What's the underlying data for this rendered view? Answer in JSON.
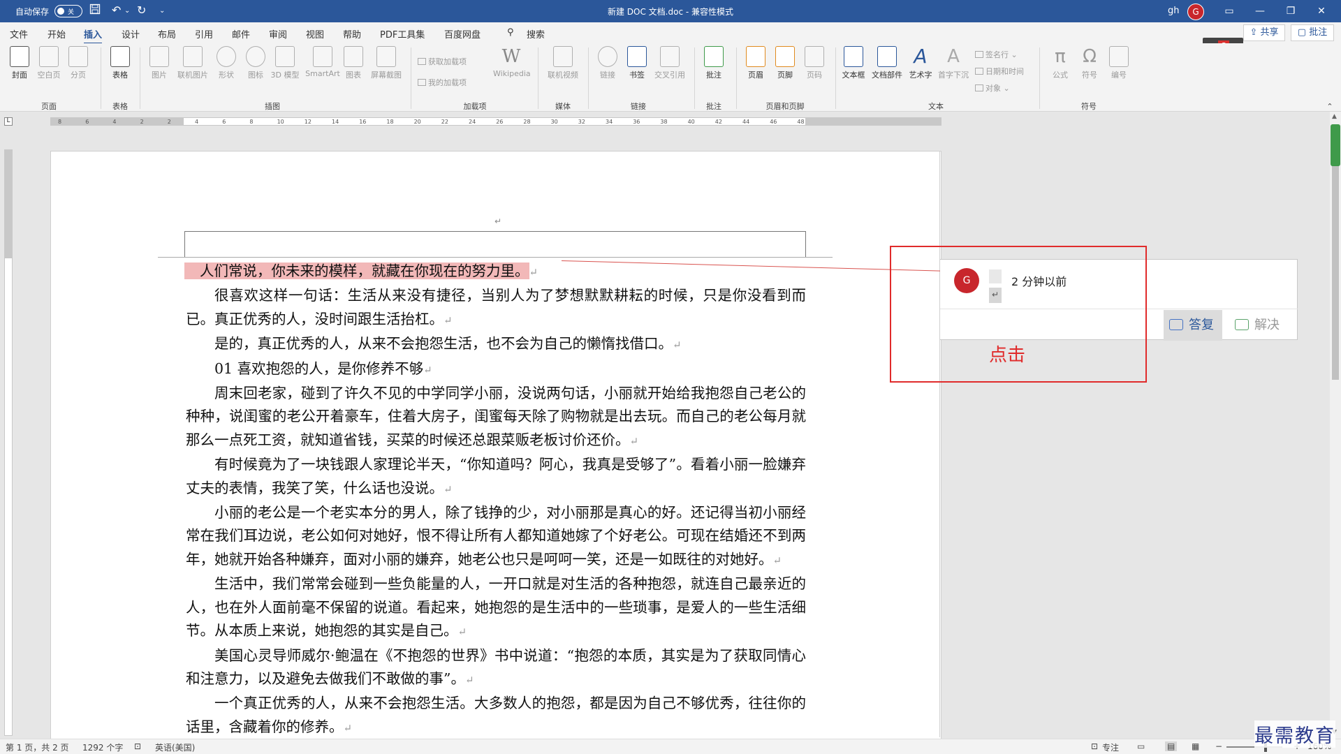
{
  "titlebar": {
    "autosave_label": "自动保存",
    "autosave_state": "关",
    "doc_title": "新建 DOC 文档.doc  -  兼容性模式",
    "user": "gh",
    "avatar_letter": "G",
    "minimize": "—",
    "restore": "❐",
    "close": "✕",
    "display_options": "▭"
  },
  "menu": {
    "tabs": [
      "文件",
      "开始",
      "插入",
      "设计",
      "布局",
      "引用",
      "邮件",
      "审阅",
      "视图",
      "帮助",
      "PDF工具集",
      "百度网盘"
    ],
    "active_tab": "插入",
    "search": "搜索",
    "share": "共享",
    "comments": "批注",
    "wps_letter": "S"
  },
  "ribbon": {
    "page": {
      "cover": "封面",
      "blank_page": "空白页",
      "page_break": "分页",
      "group": "页面"
    },
    "table": {
      "table": "表格",
      "group": "表格"
    },
    "illustrations": {
      "pictures": "图片",
      "online_pictures": "联机图片",
      "shapes": "形状",
      "icons": "图标",
      "models_3d": "3D 模型",
      "smartart": "SmartArt",
      "chart": "图表",
      "screenshot": "屏幕截图",
      "group": "插图"
    },
    "addins": {
      "get_addins": "获取加载项",
      "my_addins": "我的加载项",
      "wikipedia": "Wikipedia",
      "group": "加载项"
    },
    "media": {
      "online_video": "联机视频",
      "group": "媒体"
    },
    "links": {
      "link": "链接",
      "bookmark": "书签",
      "cross_reference": "交叉引用",
      "group": "链接"
    },
    "comments": {
      "comment": "批注",
      "group": "批注"
    },
    "header_footer": {
      "header": "页眉",
      "footer": "页脚",
      "page_number": "页码",
      "group": "页眉和页脚"
    },
    "text": {
      "text_box": "文本框",
      "quick_parts": "文档部件",
      "wordart": "艺术字",
      "drop_cap": "首字下沉",
      "signature_line": "签名行",
      "date_time": "日期和时间",
      "object": "对象",
      "group": "文本"
    },
    "symbols": {
      "equation": "公式",
      "symbol": "符号",
      "number": "编号",
      "group": "符号"
    }
  },
  "ruler": {
    "ticks": [
      "8",
      "6",
      "4",
      "2",
      "2",
      "4",
      "6",
      "8",
      "10",
      "12",
      "14",
      "16",
      "18",
      "20",
      "22",
      "24",
      "26",
      "28",
      "30",
      "32",
      "34",
      "36",
      "38",
      "40",
      "42",
      "44",
      "46",
      "48"
    ],
    "corner": "L"
  },
  "document": {
    "paragraph_mark": "↵",
    "paragraphs": [
      "人们常说，你未来的模样，就藏在你现在的努力里。",
      "很喜欢这样一句话：生活从来没有捷径，当别人为了梦想默默耕耘的时候，只是你没看到而已。真正优秀的人，没时间跟生活抬杠。",
      "是的，真正优秀的人，从来不会抱怨生活，也不会为自己的懒惰找借口。",
      "01  喜欢抱怨的人，是你修养不够",
      "周末回老家，碰到了许久不见的中学同学小丽，没说两句话，小丽就开始给我抱怨自己老公的种种，说闺蜜的老公开着豪车，住着大房子，闺蜜每天除了购物就是出去玩。而自己的老公每月就那么一点死工资，就知道省钱，买菜的时候还总跟菜贩老板讨价还价。",
      "有时候竟为了一块钱跟人家理论半天，“你知道吗？阿心，我真是受够了”。看着小丽一脸嫌弃丈夫的表情，我笑了笑，什么话也没说。",
      "小丽的老公是一个老实本分的男人，除了钱挣的少，对小丽那是真心的好。还记得当初小丽经常在我们耳边说，老公如何对她好，恨不得让所有人都知道她嫁了个好老公。可现在结婚还不到两年，她就开始各种嫌弃，面对小丽的嫌弃，她老公也只是呵呵一笑，还是一如既往的对她好。",
      "生活中，我们常常会碰到一些负能量的人，一开口就是对生活的各种抱怨，就连自己最亲近的人，也在外人面前毫不保留的说道。看起来，她抱怨的是生活中的一些琐事，是爱人的一些生活细节。从本质上来说，她抱怨的其实是自己。",
      "美国心灵导师威尔·鲍温在《不抱怨的世界》书中说道：“抱怨的本质，其实是为了获取同情心和注意力，以及避免去做我们不敢做的事”。",
      "一个真正优秀的人，从来不会抱怨生活。大多数人的抱怨，都是因为自己不够优秀，往往你的话里，含藏着你的修养。"
    ]
  },
  "comment": {
    "avatar_letter": "G",
    "time": "2 分钟以前",
    "reply": "答复",
    "resolve": "解决"
  },
  "annotation": {
    "label": "点击"
  },
  "statusbar": {
    "page": "第 1 页，共 2 页",
    "words": "1292 个字",
    "language": "英语(美国)",
    "focus": "专注",
    "zoom": "160%",
    "zoom_level": 1.6
  },
  "watermark": "最需教育"
}
